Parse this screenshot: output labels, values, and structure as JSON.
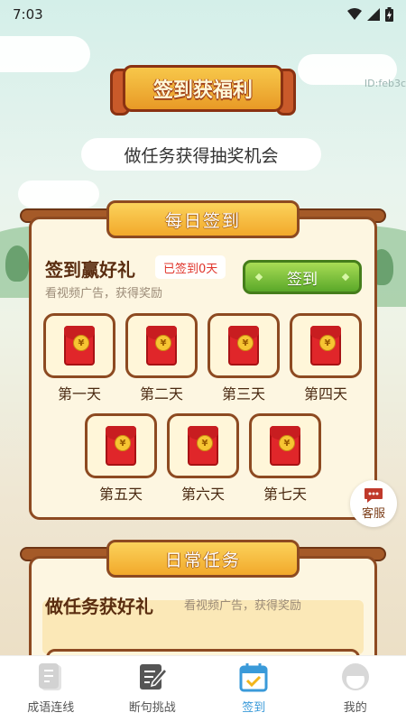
{
  "status_bar": {
    "time": "7:03"
  },
  "watermark": "ID:feb3c",
  "header": {
    "banner_title": "签到获福利",
    "subtitle": "做任务获得抽奖机会"
  },
  "daily_checkin": {
    "tab_label": "每日签到",
    "title": "签到赢好礼",
    "signed_badge": "已签到0天",
    "description": "看视频广告，获得奖励",
    "button_label": "签到",
    "days": [
      {
        "label": "第一天",
        "icon": "red-envelope-icon"
      },
      {
        "label": "第二天",
        "icon": "red-envelope-icon"
      },
      {
        "label": "第三天",
        "icon": "red-envelope-icon"
      },
      {
        "label": "第四天",
        "icon": "red-envelope-icon"
      },
      {
        "label": "第五天",
        "icon": "red-envelope-icon"
      },
      {
        "label": "第六天",
        "icon": "red-envelope-icon"
      },
      {
        "label": "第七天",
        "icon": "red-envelope-icon"
      }
    ],
    "coin_symbol": "¥"
  },
  "customer_service": {
    "label": "客服",
    "icon": "chat-bubble-icon"
  },
  "daily_tasks": {
    "tab_label": "日常任务",
    "title": "做任务获好礼",
    "description": "看视频广告，获得奖励"
  },
  "bottom_nav": {
    "items": [
      {
        "label": "成语连线",
        "icon": "idiom-link-icon",
        "active": false
      },
      {
        "label": "断句挑战",
        "icon": "edit-note-icon",
        "active": false
      },
      {
        "label": "签到",
        "icon": "calendar-check-icon",
        "active": true
      },
      {
        "label": "我的",
        "icon": "profile-icon",
        "active": false
      }
    ]
  },
  "colors": {
    "accent_active": "#3a9ad9",
    "card_border": "#8d4a21",
    "sign_button": "#5aa829",
    "envelope": "#e0262a"
  }
}
